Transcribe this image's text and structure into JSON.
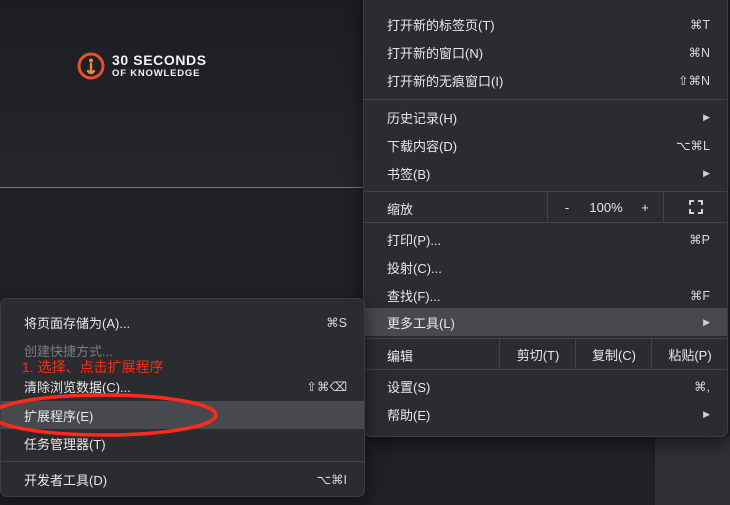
{
  "logo": {
    "line1": "30 SECONDS",
    "line2": "OF KNOWLEDGE",
    "accent": "#e8502c"
  },
  "main_menu": {
    "items": [
      {
        "label": "打开新的标签页(T)",
        "shortcut": "⌘T"
      },
      {
        "label": "打开新的窗口(N)",
        "shortcut": "⌘N"
      },
      {
        "label": "打开新的无痕窗口(I)",
        "shortcut": "⇧⌘N"
      },
      {
        "label": "历史记录(H)",
        "arrow": "▶"
      },
      {
        "label": "下载内容(D)",
        "shortcut": "⌥⌘L"
      },
      {
        "label": "书签(B)",
        "arrow": "▶"
      }
    ],
    "zoom": {
      "label": "缩放",
      "minus": "-",
      "value": "100%",
      "plus": "+"
    },
    "items2": [
      {
        "label": "打印(P)...",
        "shortcut": "⌘P"
      },
      {
        "label": "投射(C)...",
        "shortcut": ""
      },
      {
        "label": "查找(F)...",
        "shortcut": "⌘F"
      },
      {
        "label": "更多工具(L)",
        "arrow": "▶"
      }
    ],
    "edit": {
      "label": "编辑",
      "cut": "剪切(T)",
      "copy": "复制(C)",
      "paste": "粘贴(P)"
    },
    "items3": [
      {
        "label": "设置(S)",
        "shortcut": "⌘,"
      },
      {
        "label": "帮助(E)",
        "arrow": "▶"
      }
    ]
  },
  "sub_menu": {
    "items": [
      {
        "label": "将页面存储为(A)...",
        "shortcut": "⌘S"
      },
      {
        "label": "创建快捷方式...",
        "shortcut": ""
      },
      {
        "label": "清除浏览数据(C)...",
        "shortcut": "⇧⌘⌫"
      },
      {
        "label": "扩展程序(E)",
        "shortcut": ""
      },
      {
        "label": "任务管理器(T)",
        "shortcut": ""
      },
      {
        "label": "开发者工具(D)",
        "shortcut": "⌥⌘I"
      }
    ]
  },
  "annotation": {
    "text": "1. 选择、点击扩展程序",
    "color": "#ff2a1a"
  }
}
